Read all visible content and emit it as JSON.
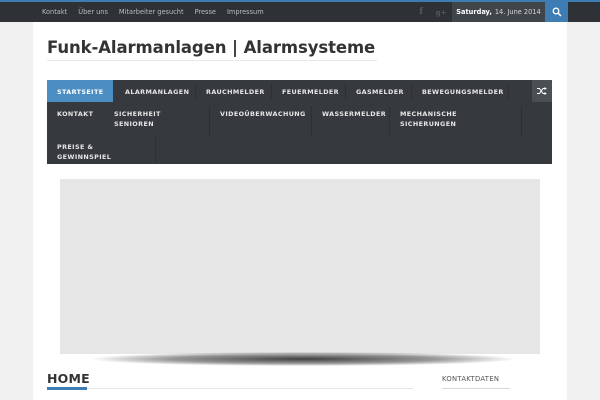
{
  "topbar": {
    "links": [
      "Kontakt",
      "Über uns",
      "Mitarbeiter gesucht",
      "Presse",
      "Impressum"
    ],
    "date_day": "Saturday,",
    "date_rest": "14. June 2014",
    "social": {
      "facebook": "f",
      "googleplus": "g+"
    }
  },
  "site": {
    "title": "Funk-Alarmanlagen | Alarmsysteme"
  },
  "nav": {
    "items": [
      "STARTSEITE",
      "ALARMANLAGEN",
      "RAUCHMELDER",
      "FEUERMELDER",
      "GASMELDER",
      "BEWEGUNGSMELDER",
      "KONTAKT",
      "SICHERHEIT\nSENIOREN",
      "VIDEOÜBERWACHUNG",
      "WASSERMELDER",
      "MECHANISCHE\nSICHERUNGEN",
      "PREISE &\nGEWINNSPIEL"
    ],
    "active_index": 0
  },
  "content": {
    "heading": "HOME"
  },
  "sidebar": {
    "heading": "KONTAKTDATEN"
  },
  "colors": {
    "accent": "#3d7db3",
    "topbar": "#2e3236",
    "nav": "#363a3e",
    "active": "#4b8ec3"
  }
}
